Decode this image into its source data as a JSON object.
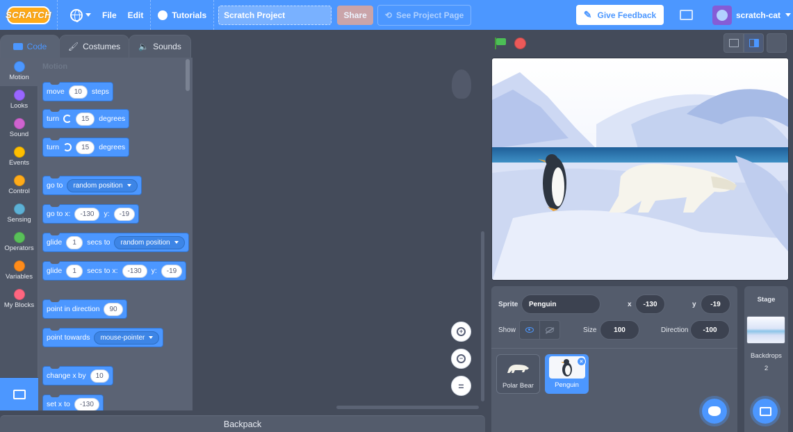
{
  "menubar": {
    "logo": "SCRATCH",
    "file": "File",
    "edit": "Edit",
    "tutorials": "Tutorials",
    "project_title": "Scratch Project",
    "share": "Share",
    "see_project_page": "See Project Page",
    "give_feedback": "Give Feedback",
    "username": "scratch-cat"
  },
  "tabs": [
    {
      "label": "Code",
      "icon": "code-icon"
    },
    {
      "label": "Costumes",
      "icon": "brush-icon"
    },
    {
      "label": "Sounds",
      "icon": "speaker-icon"
    }
  ],
  "categories": [
    {
      "label": "Motion",
      "color": "#4c97ff"
    },
    {
      "label": "Looks",
      "color": "#9966ff"
    },
    {
      "label": "Sound",
      "color": "#cf63cf"
    },
    {
      "label": "Events",
      "color": "#ffbf00"
    },
    {
      "label": "Control",
      "color": "#ffab19"
    },
    {
      "label": "Sensing",
      "color": "#5cb1d6"
    },
    {
      "label": "Operators",
      "color": "#59c059"
    },
    {
      "label": "Variables",
      "color": "#ff8c1a"
    },
    {
      "label": "My Blocks",
      "color": "#ff6680"
    }
  ],
  "palette": {
    "header": "Motion",
    "blocks": {
      "move": {
        "label": "move",
        "value": "10",
        "suffix": "steps"
      },
      "turn_right": {
        "label": "turn",
        "value": "15",
        "suffix": "degrees"
      },
      "turn_left": {
        "label": "turn",
        "value": "15",
        "suffix": "degrees"
      },
      "goto": {
        "label": "go to",
        "option": "random position"
      },
      "goto_xy": {
        "label": "go to x:",
        "x": "-130",
        "y_label": "y:",
        "y": "-19"
      },
      "glide_to": {
        "label": "glide",
        "secs": "1",
        "mid": "secs to",
        "option": "random position"
      },
      "glide_xy": {
        "label": "glide",
        "secs": "1",
        "mid": "secs to x:",
        "x": "-130",
        "y_label": "y:",
        "y": "-19"
      },
      "point_dir": {
        "label": "point in direction",
        "value": "90"
      },
      "point_towards": {
        "label": "point towards",
        "option": "mouse-pointer"
      },
      "change_x": {
        "label": "change x by",
        "value": "10"
      },
      "set_x": {
        "label": "set x to",
        "value": "-130"
      }
    }
  },
  "backpack": "Backpack",
  "sprite_info": {
    "sprite_label": "Sprite",
    "sprite_name": "Penguin",
    "x_label": "x",
    "x": "-130",
    "y_label": "y",
    "y": "-19",
    "show_label": "Show",
    "size_label": "Size",
    "size": "100",
    "direction_label": "Direction",
    "direction": "-100"
  },
  "sprites": [
    {
      "name": "Polar Bear",
      "selected": false
    },
    {
      "name": "Penguin",
      "selected": true
    }
  ],
  "stage_pane": {
    "title": "Stage",
    "backdrops_label": "Backdrops",
    "backdrops_count": "2"
  }
}
